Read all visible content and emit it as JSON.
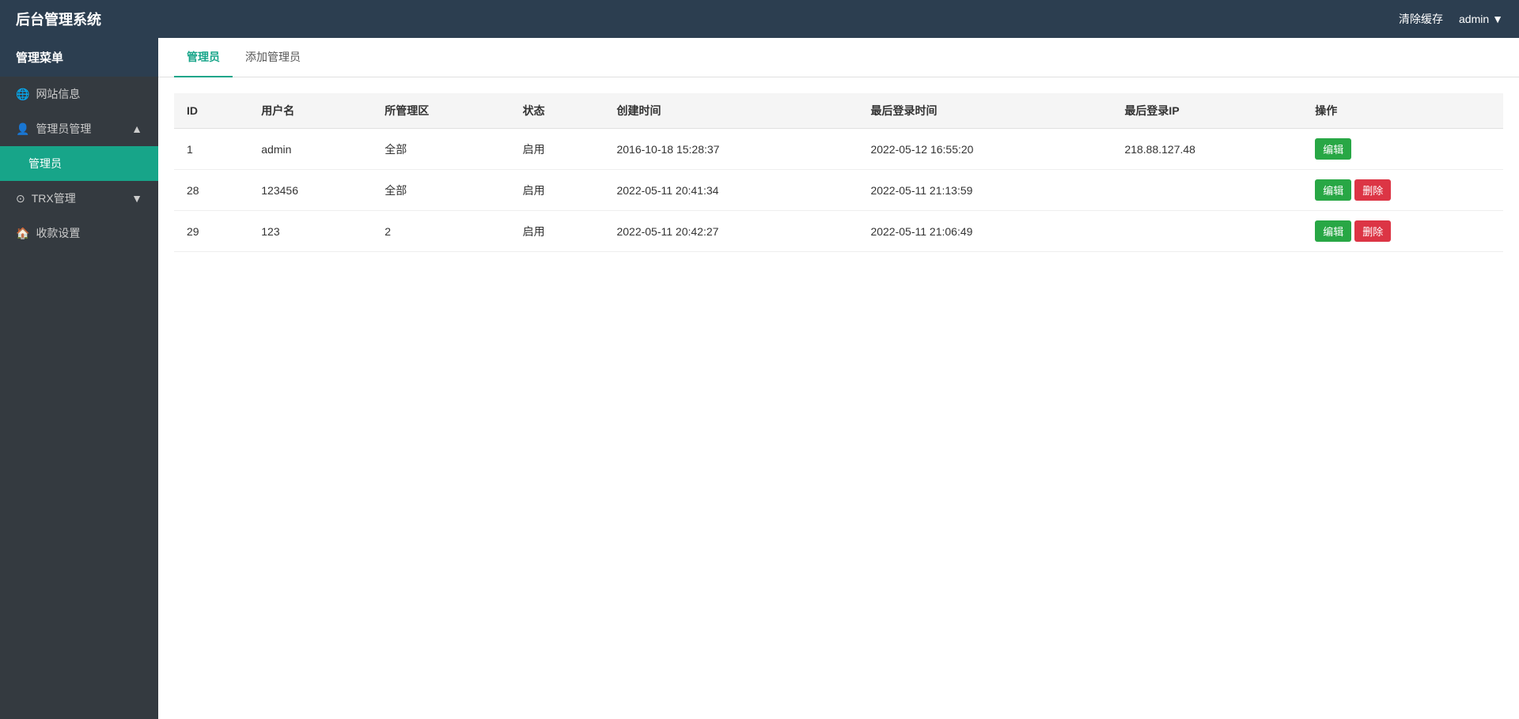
{
  "header": {
    "title": "后台管理系统",
    "clear_cache": "清除缓存",
    "user": "admin",
    "dropdown_arrow": "▼"
  },
  "sidebar": {
    "menu_label": "管理菜单",
    "items": [
      {
        "id": "website-info",
        "label": "网站信息",
        "icon": "globe-icon",
        "active": false,
        "indent": false
      },
      {
        "id": "admin-manage",
        "label": "管理员管理",
        "icon": "user-icon",
        "active": false,
        "indent": false,
        "has_arrow": true,
        "arrow": "▲"
      },
      {
        "id": "admin",
        "label": "管理员",
        "icon": "",
        "active": true,
        "indent": true
      },
      {
        "id": "trx-manage",
        "label": "TRX管理",
        "icon": "trx-icon",
        "active": false,
        "indent": false,
        "has_arrow": true,
        "arrow": "▼"
      },
      {
        "id": "payment-settings",
        "label": "收款设置",
        "icon": "home-icon",
        "active": false,
        "indent": false
      }
    ]
  },
  "tabs": [
    {
      "id": "admin-list",
      "label": "管理员",
      "active": true
    },
    {
      "id": "add-admin",
      "label": "添加管理员",
      "active": false
    }
  ],
  "table": {
    "columns": [
      {
        "id": "id",
        "label": "ID"
      },
      {
        "id": "username",
        "label": "用户名"
      },
      {
        "id": "managed_area",
        "label": "所管理区"
      },
      {
        "id": "status",
        "label": "状态"
      },
      {
        "id": "created_time",
        "label": "创建时间"
      },
      {
        "id": "last_login_time",
        "label": "最后登录时间"
      },
      {
        "id": "last_login_ip",
        "label": "最后登录IP"
      },
      {
        "id": "operation",
        "label": "操作"
      }
    ],
    "rows": [
      {
        "id": "1",
        "username": "admin",
        "managed_area": "全部",
        "status": "启用",
        "created_time": "2016-10-18 15:28:37",
        "last_login_time": "2022-05-12 16:55:20",
        "last_login_ip": "218.88.127.48",
        "can_delete": false
      },
      {
        "id": "28",
        "username": "123456",
        "managed_area": "全部",
        "status": "启用",
        "created_time": "2022-05-11 20:41:34",
        "last_login_time": "2022-05-11 21:13:59",
        "last_login_ip": "",
        "can_delete": true
      },
      {
        "id": "29",
        "username": "123",
        "managed_area": "2",
        "status": "启用",
        "created_time": "2022-05-11 20:42:27",
        "last_login_time": "2022-05-11 21:06:49",
        "last_login_ip": "",
        "can_delete": true
      }
    ],
    "btn_edit": "编辑",
    "btn_delete": "删除"
  }
}
